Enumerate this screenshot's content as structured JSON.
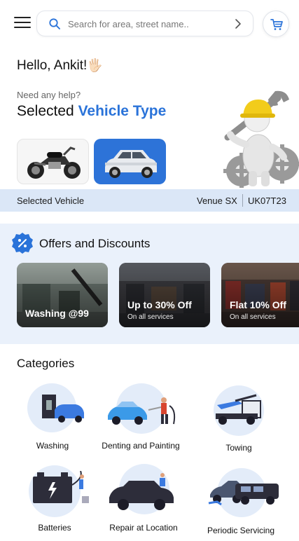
{
  "header": {
    "search_placeholder": "Search for area, street name.."
  },
  "greeting": {
    "text": "Hello, Ankit!",
    "emoji": "🖐🏻"
  },
  "help_text": "Need any help?",
  "selected_title": {
    "prefix": "Selected",
    "highlight": "Vehicle Type"
  },
  "vehicle_types": [
    {
      "name": "motorcycle",
      "selected": false
    },
    {
      "name": "car",
      "selected": true
    }
  ],
  "selected_vehicle": {
    "label": "Selected Vehicle",
    "model": "Venue SX",
    "plate": "UK07T23"
  },
  "offers": {
    "title": "Offers and Discounts",
    "items": [
      {
        "title": "Washing @99",
        "subtitle": ""
      },
      {
        "title": "Up to 30% Off",
        "subtitle": "On all services"
      },
      {
        "title": "Flat 10% Off",
        "subtitle": "On all services"
      }
    ]
  },
  "categories": {
    "title": "Categories",
    "items": [
      {
        "label": "Washing"
      },
      {
        "label": "Denting and Painting"
      },
      {
        "label": "Towing"
      },
      {
        "label": "Batteries"
      },
      {
        "label": "Repair at Location"
      },
      {
        "label": "Periodic Servicing"
      }
    ]
  },
  "colors": {
    "accent": "#2a73d9",
    "strip": "#dbe7f7",
    "offers_bg": "#eaf1fb",
    "category_circle": "#e3ecf9"
  }
}
